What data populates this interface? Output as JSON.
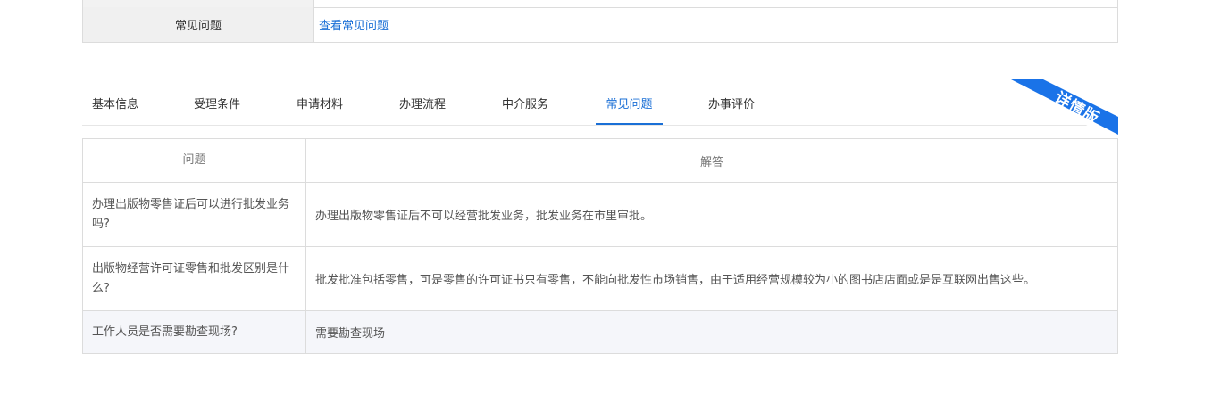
{
  "top_table": {
    "label": "常见问题",
    "link": "查看常见问题"
  },
  "tabs": [
    {
      "label": "基本信息",
      "active": false
    },
    {
      "label": "受理条件",
      "active": false
    },
    {
      "label": "申请材料",
      "active": false
    },
    {
      "label": "办理流程",
      "active": false
    },
    {
      "label": "中介服务",
      "active": false
    },
    {
      "label": "常见问题",
      "active": true
    },
    {
      "label": "办事评价",
      "active": false
    }
  ],
  "ribbon": {
    "text": "详情版",
    "color": "#1a73e8"
  },
  "faq": {
    "headers": {
      "question": "问题",
      "answer": "解答"
    },
    "rows": [
      {
        "question": "办理出版物零售证后可以进行批发业务吗?",
        "answer": "办理出版物零售证后不可以经营批发业务，批发业务在市里审批。"
      },
      {
        "question": "出版物经营许可证零售和批发区别是什么?",
        "answer": "批发批准包括零售，可是零售的许可证书只有零售，不能向批发性市场销售，由于适用经营规模较为小的图书店店面或是是互联网出售这些。"
      },
      {
        "question": "工作人员是否需要勘查现场?",
        "answer": "需要勘查现场"
      }
    ]
  },
  "colors": {
    "accent": "#1a6fd6",
    "border": "#dcdcdc",
    "label_bg": "#f0f0f0"
  }
}
